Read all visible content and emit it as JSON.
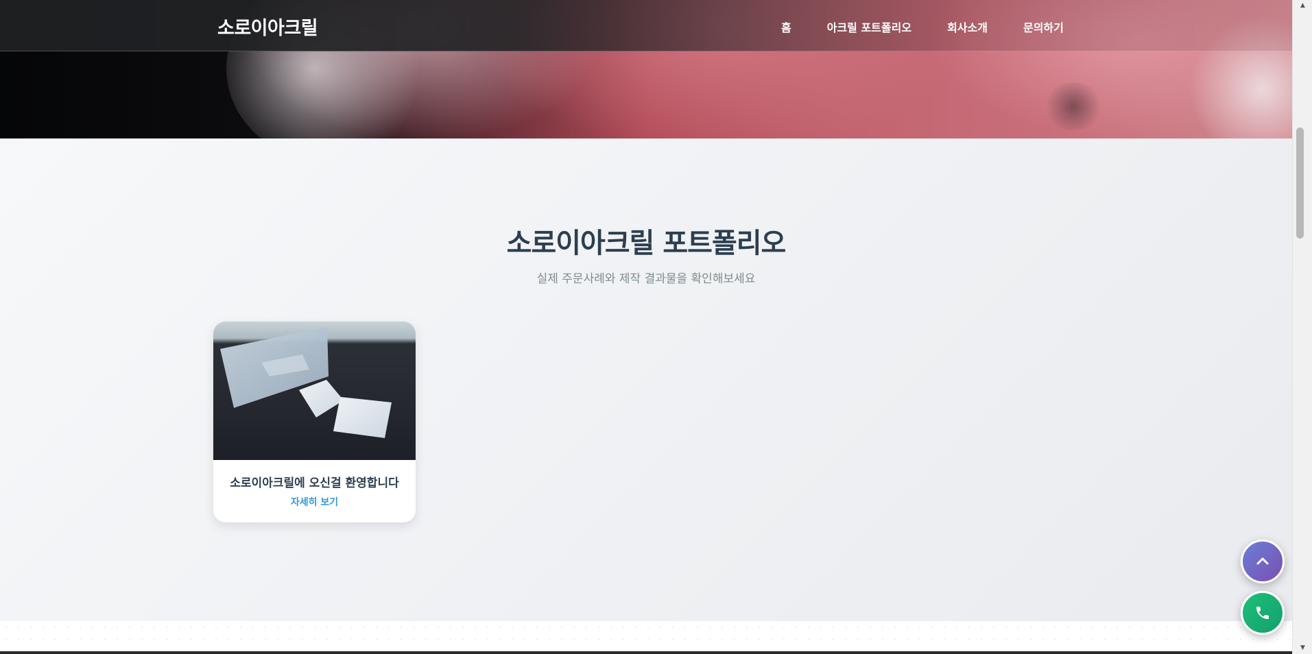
{
  "brand": "소로이아크릴",
  "nav": {
    "items": [
      "홈",
      "아크릴 포트폴리오",
      "회사소개",
      "문의하기"
    ]
  },
  "portfolio": {
    "title": "소로이아크릴 포트폴리오",
    "subtitle": "실제 주문사례와 제작 결과물을 확인해보세요",
    "cards": [
      {
        "title": "소로이아크릴에 오신걸 환영합니다",
        "link": "자세히 보기"
      }
    ]
  },
  "floating": {
    "top_icon": "chevron-up-icon",
    "call_icon": "phone-icon"
  },
  "colors": {
    "heading": "#2c3e50",
    "link": "#3498db",
    "call_button": "#1fbf7a",
    "top_button": "#6a7fd8"
  }
}
